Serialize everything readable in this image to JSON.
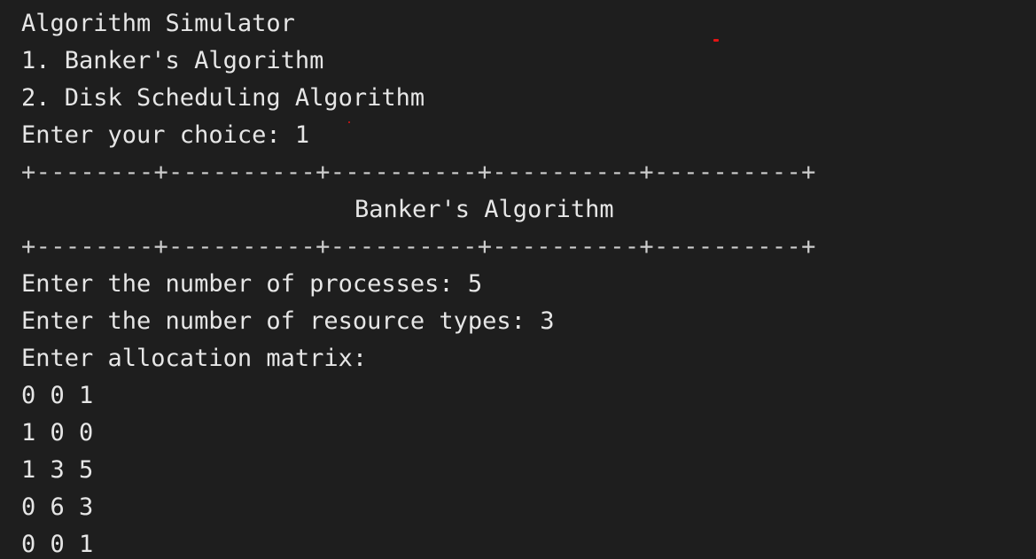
{
  "menu": {
    "title": "Algorithm Simulator",
    "option_1": "1. Banker's Algorithm",
    "option_2": "2. Disk Scheduling Algorithm",
    "choice_prompt": "Enter your choice: 1"
  },
  "banner": {
    "border_top": "+--------+----------+----------+----------+----------+",
    "heading": "Banker's Algorithm",
    "border_bottom": "+--------+----------+----------+----------+----------+"
  },
  "prompts": {
    "processes": "Enter the number of processes: 5",
    "resource_types": "Enter the number of resource types: 3",
    "allocation_header": "Enter allocation matrix:"
  },
  "allocation_matrix": {
    "rows": [
      "0 0 1",
      "1 0 0",
      "1 3 5",
      "0 6 3",
      "0 0 1"
    ]
  },
  "colors": {
    "background": "#1e1e1e",
    "text": "#e6e6e6",
    "stray_mark": "#e51414"
  }
}
